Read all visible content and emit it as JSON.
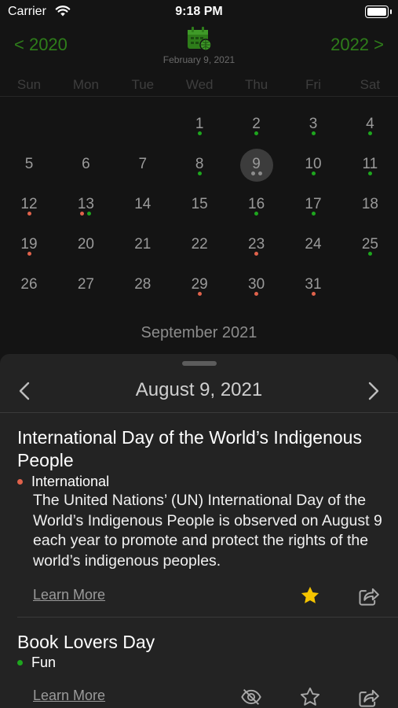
{
  "status_bar": {
    "carrier": "Carrier",
    "time": "9:18 PM"
  },
  "calendar": {
    "prev_year": "< 2020",
    "next_year": "2022 >",
    "header_date": "February 9, 2021",
    "weekdays": [
      "Sun",
      "Mon",
      "Tue",
      "Wed",
      "Thu",
      "Fri",
      "Sat"
    ],
    "start_weekday_index": 3,
    "selected_day": 9,
    "colors": {
      "green": "#1ea61e",
      "red": "#e0624b",
      "gray": "#8c8c8c"
    },
    "days": [
      {
        "n": "1",
        "dots": [
          "green"
        ]
      },
      {
        "n": "2",
        "dots": [
          "green"
        ]
      },
      {
        "n": "3",
        "dots": [
          "green"
        ]
      },
      {
        "n": "4",
        "dots": [
          "green"
        ]
      },
      {
        "n": "5",
        "dots": []
      },
      {
        "n": "6",
        "dots": []
      },
      {
        "n": "7",
        "dots": []
      },
      {
        "n": "8",
        "dots": [
          "green"
        ]
      },
      {
        "n": "9",
        "dots": [
          "gray",
          "gray"
        ]
      },
      {
        "n": "10",
        "dots": [
          "green"
        ]
      },
      {
        "n": "11",
        "dots": [
          "green"
        ]
      },
      {
        "n": "12",
        "dots": [
          "red"
        ]
      },
      {
        "n": "13",
        "dots": [
          "red",
          "green"
        ]
      },
      {
        "n": "14",
        "dots": []
      },
      {
        "n": "15",
        "dots": []
      },
      {
        "n": "16",
        "dots": [
          "green"
        ]
      },
      {
        "n": "17",
        "dots": [
          "green"
        ]
      },
      {
        "n": "18",
        "dots": []
      },
      {
        "n": "19",
        "dots": [
          "red"
        ]
      },
      {
        "n": "20",
        "dots": []
      },
      {
        "n": "21",
        "dots": []
      },
      {
        "n": "22",
        "dots": []
      },
      {
        "n": "23",
        "dots": [
          "red"
        ]
      },
      {
        "n": "24",
        "dots": []
      },
      {
        "n": "25",
        "dots": [
          "green"
        ]
      },
      {
        "n": "26",
        "dots": []
      },
      {
        "n": "27",
        "dots": []
      },
      {
        "n": "28",
        "dots": []
      },
      {
        "n": "29",
        "dots": [
          "red"
        ]
      },
      {
        "n": "30",
        "dots": [
          "red"
        ]
      },
      {
        "n": "31",
        "dots": [
          "red"
        ]
      }
    ],
    "month_label": "September 2021"
  },
  "sheet": {
    "date_title": "August 9, 2021",
    "prev_icon": "chevron-left-icon",
    "next_icon": "chevron-right-icon",
    "events": [
      {
        "title": "International Day of the World’s Indigenous People",
        "category": "International",
        "category_color": "#e0624b",
        "description": "The United Nations’ (UN) International Day of the World’s Indigenous People is observed on August 9 each year to promote and protect the rights of the world’s indigenous peoples.",
        "learn_more": "Learn More",
        "favorited": true,
        "icons": [
          "star-filled-icon",
          "share-icon"
        ]
      },
      {
        "title": "Book Lovers Day",
        "category": "Fun",
        "category_color": "#1ea61e",
        "learn_more": "Learn More",
        "favorited": false,
        "icons": [
          "hide-icon",
          "star-outline-icon",
          "share-icon"
        ]
      }
    ]
  }
}
